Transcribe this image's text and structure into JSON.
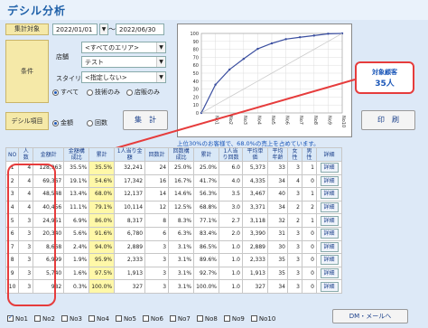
{
  "title": "デシル分析",
  "period": {
    "label": "集計対象",
    "from": "2022/01/01",
    "sep": "～",
    "to": "2022/06/30"
  },
  "conditions": {
    "label": "条件",
    "store_label": "店舗",
    "area": "<すべてのエリア>",
    "store": "テスト",
    "stylist_label": "スタイリスト",
    "stylist": "<指定しない>",
    "radios": [
      {
        "label": "すべて",
        "checked": true
      },
      {
        "label": "技術のみ",
        "checked": false
      },
      {
        "label": "店販のみ",
        "checked": false
      }
    ]
  },
  "decile": {
    "label": "デシル項目",
    "radios": [
      {
        "label": "金額",
        "checked": true
      },
      {
        "label": "回数",
        "checked": false
      }
    ]
  },
  "buttons": {
    "aggregate": "集　計",
    "print": "印　刷",
    "dm": "DM・メールへ"
  },
  "callout": {
    "line1": "対象顧客",
    "line2": "35人"
  },
  "summary": "上位30%のお客様で、68.0%の売上を占めています。",
  "chart_data": {
    "type": "line",
    "title": "",
    "xlabel": "",
    "ylabel": "",
    "categories": [
      "No1",
      "No2",
      "No3",
      "No4",
      "No5",
      "No6",
      "No7",
      "No8",
      "No9",
      "No10"
    ],
    "series": [
      {
        "values": [
          0,
          35.5,
          54.6,
          68.0,
          80.6,
          87.5,
          92.8,
          95.2,
          97.3,
          99.6,
          100
        ]
      },
      {
        "values": [
          0,
          10,
          20,
          30,
          40,
          50,
          60,
          70,
          80,
          90,
          100
        ]
      }
    ],
    "ylim": [
      0,
      100
    ],
    "yticks": [
      "0",
      "10",
      "20",
      "30",
      "40",
      "50",
      "60",
      "70",
      "80",
      "90",
      "100"
    ],
    "grid": true
  },
  "table": {
    "headers": [
      "NO",
      "人数",
      "金額計",
      "金額構成比",
      "累計",
      "1人当り金額",
      "回数計",
      "回数構成比",
      "累計",
      "1人当り回数",
      "平均単価",
      "平均年齢",
      "女性",
      "男性",
      "詳細"
    ],
    "rows": [
      [
        "1",
        "4",
        "128,963",
        "35.5%",
        "35.5%",
        "32,241",
        "24",
        "25.0%",
        "25.0%",
        "6.0",
        "5,373",
        "33",
        "3",
        "1",
        "詳細"
      ],
      [
        "2",
        "4",
        "69,367",
        "19.1%",
        "54.6%",
        "17,342",
        "16",
        "16.7%",
        "41.7%",
        "4.0",
        "4,335",
        "34",
        "4",
        "0",
        "詳細"
      ],
      [
        "3",
        "4",
        "48,548",
        "13.4%",
        "68.0%",
        "12,137",
        "14",
        "14.6%",
        "56.3%",
        "3.5",
        "3,467",
        "40",
        "3",
        "1",
        "詳細"
      ],
      [
        "4",
        "4",
        "40,456",
        "11.1%",
        "79.1%",
        "10,114",
        "12",
        "12.5%",
        "68.8%",
        "3.0",
        "3,371",
        "34",
        "2",
        "2",
        "詳細"
      ],
      [
        "5",
        "3",
        "24,951",
        "6.9%",
        "86.0%",
        "8,317",
        "8",
        "8.3%",
        "77.1%",
        "2.7",
        "3,118",
        "32",
        "2",
        "1",
        "詳細"
      ],
      [
        "6",
        "3",
        "20,340",
        "5.6%",
        "91.6%",
        "6,780",
        "6",
        "6.3%",
        "83.4%",
        "2.0",
        "3,390",
        "31",
        "3",
        "0",
        "詳細"
      ],
      [
        "7",
        "3",
        "8,668",
        "2.4%",
        "94.0%",
        "2,889",
        "3",
        "3.1%",
        "86.5%",
        "1.0",
        "2,889",
        "30",
        "3",
        "0",
        "詳細"
      ],
      [
        "8",
        "3",
        "6,999",
        "1.9%",
        "95.9%",
        "2,333",
        "3",
        "3.1%",
        "89.6%",
        "1.0",
        "2,333",
        "35",
        "3",
        "0",
        "詳細"
      ],
      [
        "9",
        "3",
        "5,740",
        "1.6%",
        "97.5%",
        "1,913",
        "3",
        "3.1%",
        "92.7%",
        "1.0",
        "1,913",
        "35",
        "3",
        "0",
        "詳細"
      ],
      [
        "10",
        "3",
        "982",
        "0.3%",
        "100.0%",
        "327",
        "3",
        "3.1%",
        "100.0%",
        "1.0",
        "327",
        "34",
        "3",
        "0",
        "詳細"
      ]
    ]
  },
  "footer": [
    {
      "label": "No1",
      "checked": true
    },
    {
      "label": "No2",
      "checked": false
    },
    {
      "label": "No3",
      "checked": false
    },
    {
      "label": "No4",
      "checked": false
    },
    {
      "label": "No5",
      "checked": false
    },
    {
      "label": "No6",
      "checked": false
    },
    {
      "label": "No7",
      "checked": false
    },
    {
      "label": "No8",
      "checked": false
    },
    {
      "label": "No9",
      "checked": false
    },
    {
      "label": "No10",
      "checked": false
    }
  ]
}
